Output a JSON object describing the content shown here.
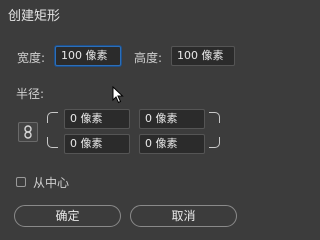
{
  "dialog": {
    "title": "创建矩形"
  },
  "size": {
    "width_label": "宽度:",
    "width_value": "100 像素",
    "height_label": "高度:",
    "height_value": "100 像素"
  },
  "radius": {
    "label": "半径:",
    "top_left": "0 像素",
    "top_right": "0 像素",
    "bottom_left": "0 像素",
    "bottom_right": "0 像素",
    "link_icon": "link-icon"
  },
  "options": {
    "from_center_label": "从中心",
    "from_center_checked": false
  },
  "buttons": {
    "ok_label": "确定",
    "cancel_label": "取消"
  },
  "colors": {
    "focus": "#2d6fb8",
    "background": "#3c3c3c",
    "field": "#2b2b2b"
  }
}
